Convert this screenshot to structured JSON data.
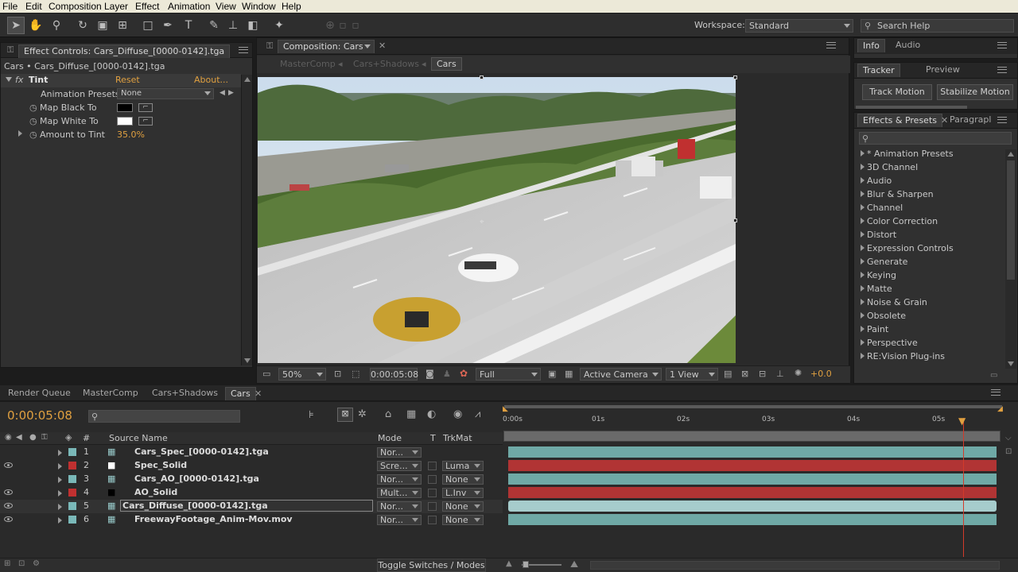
{
  "menu": [
    "File",
    "Edit",
    "Composition",
    "Layer",
    "Effect",
    "Animation",
    "View",
    "Window",
    "Help"
  ],
  "toolbar": {
    "workspace_label": "Workspace:",
    "workspace_value": "Standard",
    "search_placeholder": "Search Help"
  },
  "effect_controls": {
    "tab_label": "Effect Controls: Cars_Diffuse_[0000-0142].tga",
    "breadcrumb": "Cars • Cars_Diffuse_[0000-0142].tga",
    "effect_name": "Tint",
    "reset": "Reset",
    "about": "About...",
    "animation_presets_label": "Animation Presets:",
    "animation_presets_value": "None",
    "map_black_label": "Map Black To",
    "map_white_label": "Map White To",
    "amount_label": "Amount to Tint",
    "amount_value": "35.0%"
  },
  "composition": {
    "tab_label": "Composition: Cars",
    "crumbs": [
      "MasterComp",
      "Cars+Shadows",
      "Cars"
    ],
    "zoom": "50%",
    "timecode": "0:00:05:08",
    "resolution": "Full",
    "camera": "Active Camera",
    "views": "1 View",
    "exposure": "+0.0"
  },
  "info_panel": {
    "tabs": [
      "Info",
      "Audio"
    ]
  },
  "tracker_panel": {
    "tabs": [
      "Tracker",
      "Preview"
    ],
    "track_motion": "Track Motion",
    "stabilize_motion": "Stabilize Motion"
  },
  "effects_presets": {
    "tabs": [
      "Effects & Presets",
      "Paragrapl"
    ],
    "items": [
      "* Animation Presets",
      "3D Channel",
      "Audio",
      "Blur & Sharpen",
      "Channel",
      "Color Correction",
      "Distort",
      "Expression Controls",
      "Generate",
      "Keying",
      "Matte",
      "Noise & Grain",
      "Obsolete",
      "Paint",
      "Perspective",
      "RE:Vision Plug-ins"
    ]
  },
  "timeline": {
    "tabs": [
      "Render Queue",
      "MasterComp",
      "Cars+Shadows",
      "Cars"
    ],
    "current_time": "0:00:05:08",
    "columns": {
      "num": "#",
      "source": "Source Name",
      "mode": "Mode",
      "t": "T",
      "trkmat": "TrkMat"
    },
    "ruler": [
      "0:00s",
      "01s",
      "02s",
      "03s",
      "04s",
      "05s"
    ],
    "layers": [
      {
        "num": "1",
        "name": "Cars_Spec_[0000-0142].tga",
        "mode": "Nor...",
        "trkmat": "",
        "label": "#7ab8b8",
        "bar": "#6fa9a6",
        "visible": false
      },
      {
        "num": "2",
        "name": "Spec_Solid",
        "mode": "Scre...",
        "trkmat": "Luma",
        "label": "#c03030",
        "bar": "#b13434",
        "visible": true
      },
      {
        "num": "3",
        "name": "Cars_AO_[0000-0142].tga",
        "mode": "Nor...",
        "trkmat": "None",
        "label": "#7ab8b8",
        "bar": "#6fa9a6",
        "visible": false
      },
      {
        "num": "4",
        "name": "AO_Solid",
        "mode": "Mult...",
        "trkmat": "L.Inv",
        "label": "#c03030",
        "bar": "#b13434",
        "visible": true
      },
      {
        "num": "5",
        "name": "Cars_Diffuse_[0000-0142].tga",
        "mode": "Nor...",
        "trkmat": "None",
        "label": "#7ab8b8",
        "bar": "#a6cccc",
        "visible": true
      },
      {
        "num": "6",
        "name": "FreewayFootage_Anim-Mov.mov",
        "mode": "Nor...",
        "trkmat": "None",
        "label": "#7ab8b8",
        "bar": "#6fa9a6",
        "visible": true
      }
    ],
    "toggle_label": "Toggle Switches / Modes"
  },
  "colors": {
    "accent": "#e0a040",
    "playhead": "#d33a2a"
  }
}
